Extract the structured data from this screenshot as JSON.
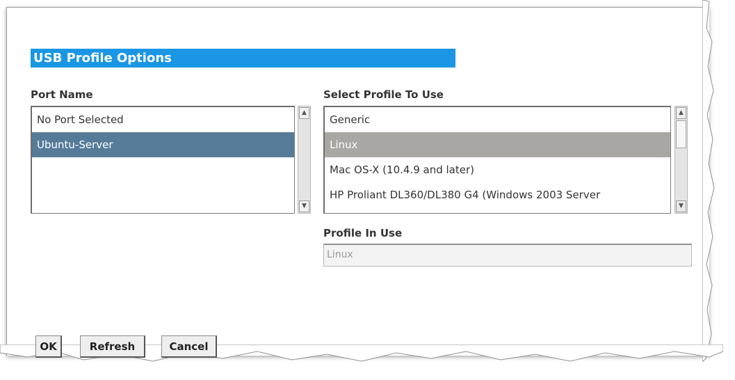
{
  "dialog": {
    "title": "USB Profile Options"
  },
  "port_name": {
    "label": "Port Name",
    "items": [
      "No Port Selected",
      "Ubuntu-Server"
    ],
    "selected_index": 1
  },
  "profiles": {
    "label": "Select Profile To Use",
    "items": [
      "Generic",
      "Linux",
      "Mac OS-X (10.4.9 and later)",
      "HP Proliant DL360/DL380 G4 (Windows 2003 Server"
    ],
    "selected_index": 1
  },
  "profile_in_use": {
    "label": "Profile In Use",
    "value": "Linux"
  },
  "buttons": {
    "ok": "OK",
    "refresh": "Refresh",
    "cancel": "Cancel"
  },
  "colors": {
    "title_bar": "#1a96e4",
    "port_selection": "#557b99",
    "profile_selection": "#a9a7a3"
  }
}
